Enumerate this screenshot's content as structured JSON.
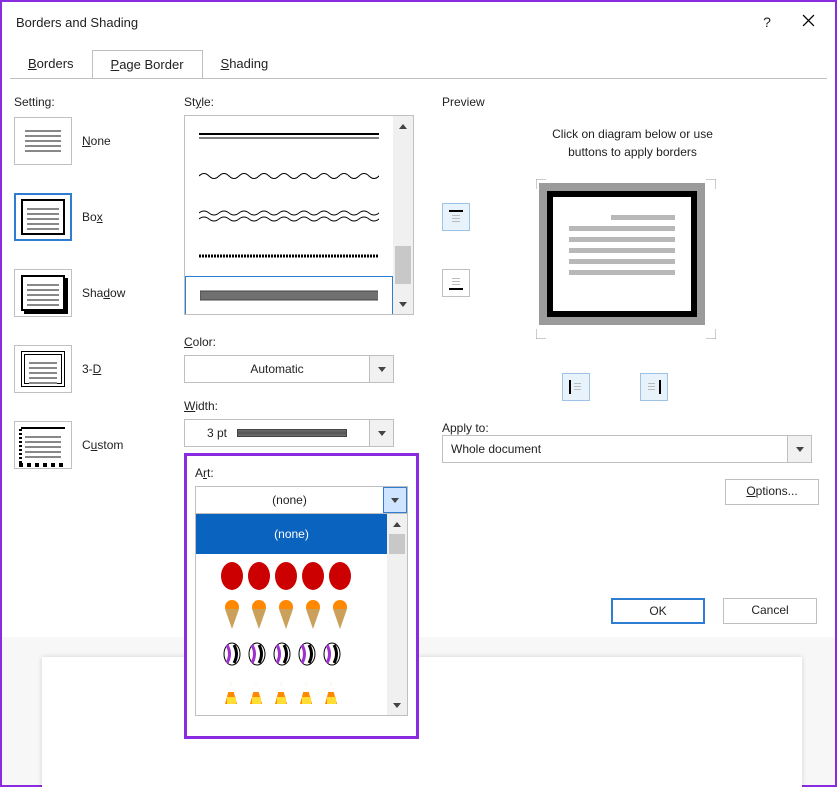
{
  "titlebar": {
    "title": "Borders and Shading",
    "help_label": "?",
    "close_label": "Close"
  },
  "tabs": {
    "borders": "Borders",
    "page_border": "Page Border",
    "shading": "Shading",
    "active": "page_border"
  },
  "setting": {
    "label": "Setting:",
    "items": [
      {
        "key": "none",
        "label": "None",
        "underline": "N"
      },
      {
        "key": "box",
        "label": "Box",
        "underline": "x"
      },
      {
        "key": "shadow",
        "label": "Shadow",
        "underline": "d"
      },
      {
        "key": "threeD",
        "label": "3-D",
        "underline": "D"
      },
      {
        "key": "custom",
        "label": "Custom",
        "underline": "u"
      }
    ],
    "selected": "box"
  },
  "style": {
    "label": "Style:",
    "selected_index": 4
  },
  "color": {
    "label": "Color:",
    "value": "Automatic"
  },
  "width": {
    "label": "Width:",
    "value": "3 pt"
  },
  "art": {
    "label": "Art:",
    "value": "(none)",
    "dropdown_open": true,
    "options": [
      "(none)",
      "art-red-apples",
      "art-icecream",
      "art-candy",
      "art-candycorn"
    ]
  },
  "preview": {
    "label": "Preview",
    "hint_line1": "Click on diagram below or use",
    "hint_line2": "buttons to apply borders"
  },
  "apply_to": {
    "label": "Apply to:",
    "value": "Whole document"
  },
  "options_button": "Options...",
  "ok_button": "OK",
  "cancel_button": "Cancel"
}
